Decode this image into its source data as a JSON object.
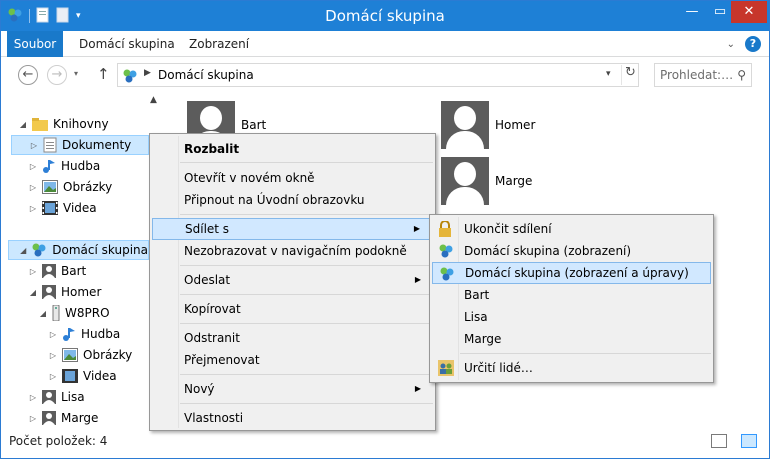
{
  "window": {
    "title": "Domácí skupina"
  },
  "ribbon": {
    "tabs": [
      "Soubor",
      "Domácí skupina",
      "Zobrazení"
    ],
    "help_label": "?",
    "expand_label": "⌄"
  },
  "address": {
    "breadcrumb": "Domácí skupina",
    "search_placeholder": "Prohledat:…"
  },
  "nav_tree": {
    "knihovny": "Knihovny",
    "dokumenty": "Dokumenty",
    "hudba": "Hudba",
    "obrazky": "Obrázky",
    "videa": "Videa",
    "domaci_skupina": "Domácí skupina",
    "bart": "Bart",
    "homer": "Homer",
    "w8pro": "W8PRO",
    "w8_hudba": "Hudba",
    "w8_obrazky": "Obrázky",
    "w8_videa": "Videa",
    "lisa": "Lisa",
    "marge": "Marge"
  },
  "content_tiles": [
    "Bart",
    "Homer",
    "Marge"
  ],
  "status": {
    "item_count": "Počet položek: 4"
  },
  "context_menu": {
    "expand": "Rozbalit",
    "open_new_window": "Otevřít v novém okně",
    "pin_start": "Připnout na Úvodní obrazovku",
    "share_with": "Sdílet s",
    "hide_in_nav": "Nezobrazovat v navigačním podokně",
    "send_to": "Odeslat",
    "copy": "Kopírovat",
    "delete": "Odstranit",
    "rename": "Přejmenovat",
    "new": "Nový",
    "properties": "Vlastnosti"
  },
  "share_submenu": {
    "stop_sharing": "Ukončit sdílení",
    "homegroup_view": "Domácí skupina (zobrazení)",
    "homegroup_view_edit": "Domácí skupina (zobrazení a úpravy)",
    "bart": "Bart",
    "lisa": "Lisa",
    "marge": "Marge",
    "specific_people": "Určití lidé…"
  },
  "colors": {
    "title_bar": "#1e80d6",
    "file_tab": "#1979ca",
    "selection": "#cce8ff",
    "menu_highlight": "#d1e8ff",
    "close_button": "#c7362b"
  }
}
